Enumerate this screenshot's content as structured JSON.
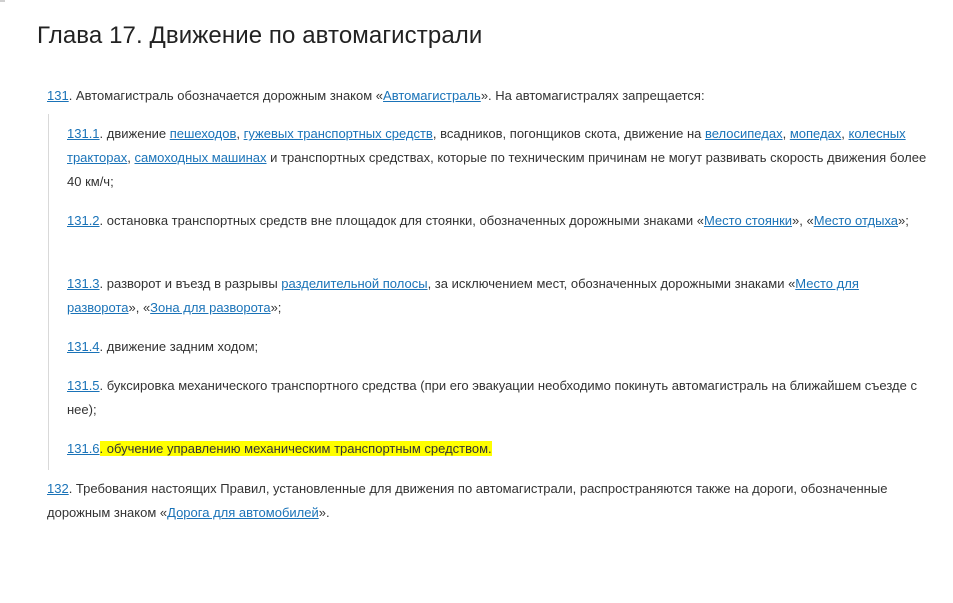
{
  "chapter_title": "Глава 17. Движение по автомагистрали",
  "p131": {
    "num": "131",
    "text1": ". Автомагистраль обозначается дорожным знаком «",
    "link_sign": "Автомагистраль",
    "text2": "». На автомагистралях запрещается:"
  },
  "items": [
    {
      "num": "131.1",
      "t1": ". движение ",
      "l1": "пешеходов",
      "t2": ", ",
      "l2": "гужевых транспортных средств",
      "t3": ", всадников, погонщиков скота, движение на ",
      "l3": "велосипедах",
      "t4": ", ",
      "l4": "мопедах",
      "t5": ", ",
      "l5": "колесных тракторах",
      "t6": ", ",
      "l6": "самоходных машинах",
      "t7": " и транспортных средствах, которые по техническим причинам не могут развивать скорость движения более 40 км/ч;"
    },
    {
      "num": "131.2",
      "t1": ". остановка транспортных средств вне площадок для стоянки, обозначенных дорожными знаками «",
      "l1": "Место стоянки",
      "t2": "», «",
      "l2": "Место отдыха",
      "t3": "»;"
    },
    {
      "num": "131.3",
      "t1": ". разворот и въезд в разрывы ",
      "l1": "разделительной полосы",
      "t2": ", за исключением мест, обозначенных дорожными знаками «",
      "l2": "Место для разворота",
      "t3": "», «",
      "l3": "Зона для разворота",
      "t4": "»;"
    },
    {
      "num": "131.4",
      "t1": ". движение задним ходом;"
    },
    {
      "num": "131.5",
      "t1": ". буксировка механического транспортного средства (при его эвакуации необходимо покинуть автомагистраль на ближайшем съезде с нее);"
    },
    {
      "num": "131.6",
      "t1": ". обучение управлению механическим транспортным средством."
    }
  ],
  "p132": {
    "num": "132",
    "text1": ". Требования настоящих Правил, установленные для движения по автомагистрали, распространяются также на дороги, обозначенные дорожным знаком «",
    "link_sign": "Дорога для автомобилей",
    "text2": "»."
  },
  "colors": {
    "link": "#1a73b8",
    "highlight": "#ffff00",
    "text": "#333333",
    "border": "#d9d9d9"
  }
}
